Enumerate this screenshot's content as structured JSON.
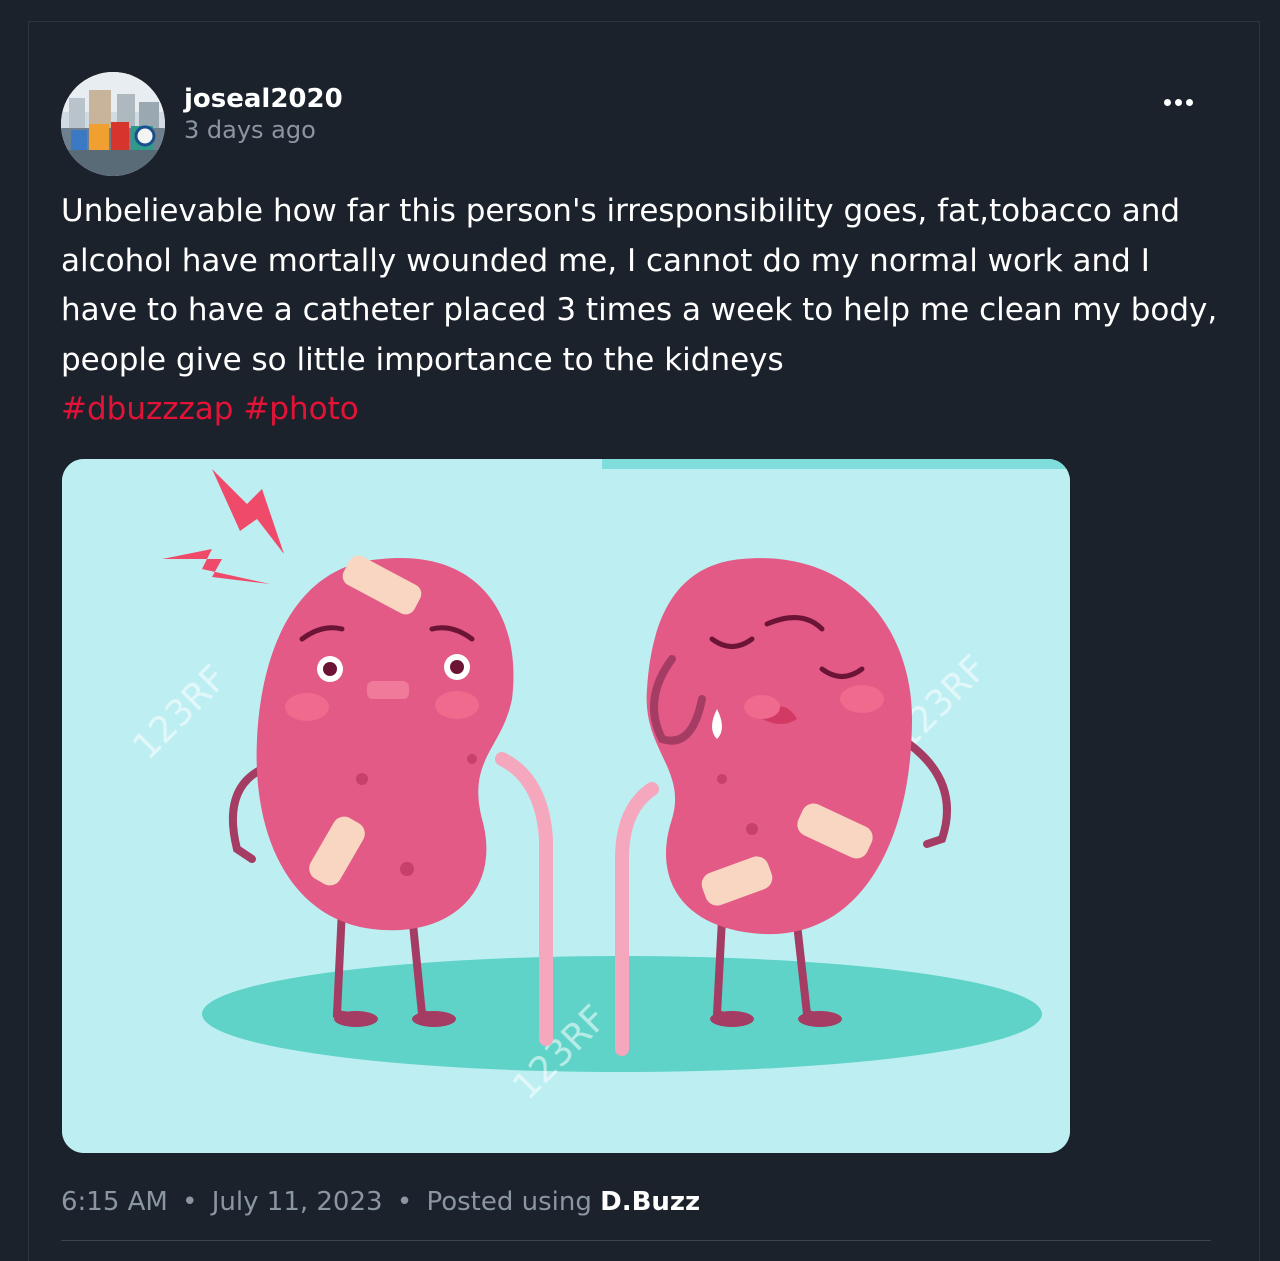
{
  "post": {
    "author": "joseal2020",
    "time_ago": "3 days ago",
    "body": "Unbelievable how far this person's irresponsibility goes, fat,tobacco and alcohol have mortally wounded me, I cannot do my normal work and I have to have a catheter placed 3 times a week to help me clean my body, people give so little importance to the kidneys",
    "tags": [
      "#dbuzzzap",
      "#photo"
    ],
    "watermarks": [
      "123RF",
      "123RF",
      "123RF"
    ],
    "footer": {
      "time": "6:15 AM",
      "date": "July 11, 2023",
      "posted_using_label": "Posted using",
      "app_name": "D.Buzz",
      "separator": "•"
    }
  },
  "icons": {
    "menu": "more-dots-icon",
    "avatar": "user-avatar-image"
  },
  "colors": {
    "background": "#1b222b",
    "text": "#ffffff",
    "muted": "#8b96a3",
    "hashtag": "#e31337",
    "image_background": "#bdeff2"
  }
}
